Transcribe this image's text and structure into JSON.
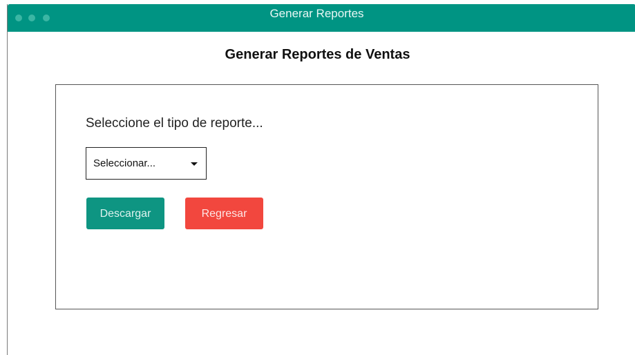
{
  "window": {
    "title": "Generar Reportes",
    "titlebar_color": "#009483",
    "controls": [
      "close-dot",
      "minimize-dot",
      "maximize-dot"
    ]
  },
  "page": {
    "heading": "Generar Reportes de Ventas"
  },
  "form": {
    "prompt": "Seleccione el tipo de reporte...",
    "select": {
      "value": "Seleccionar...",
      "icon": "caret-down-icon"
    },
    "buttons": {
      "download_label": "Descargar",
      "download_color": "#0e9582",
      "back_label": "Regresar",
      "back_color": "#f2473e"
    }
  }
}
